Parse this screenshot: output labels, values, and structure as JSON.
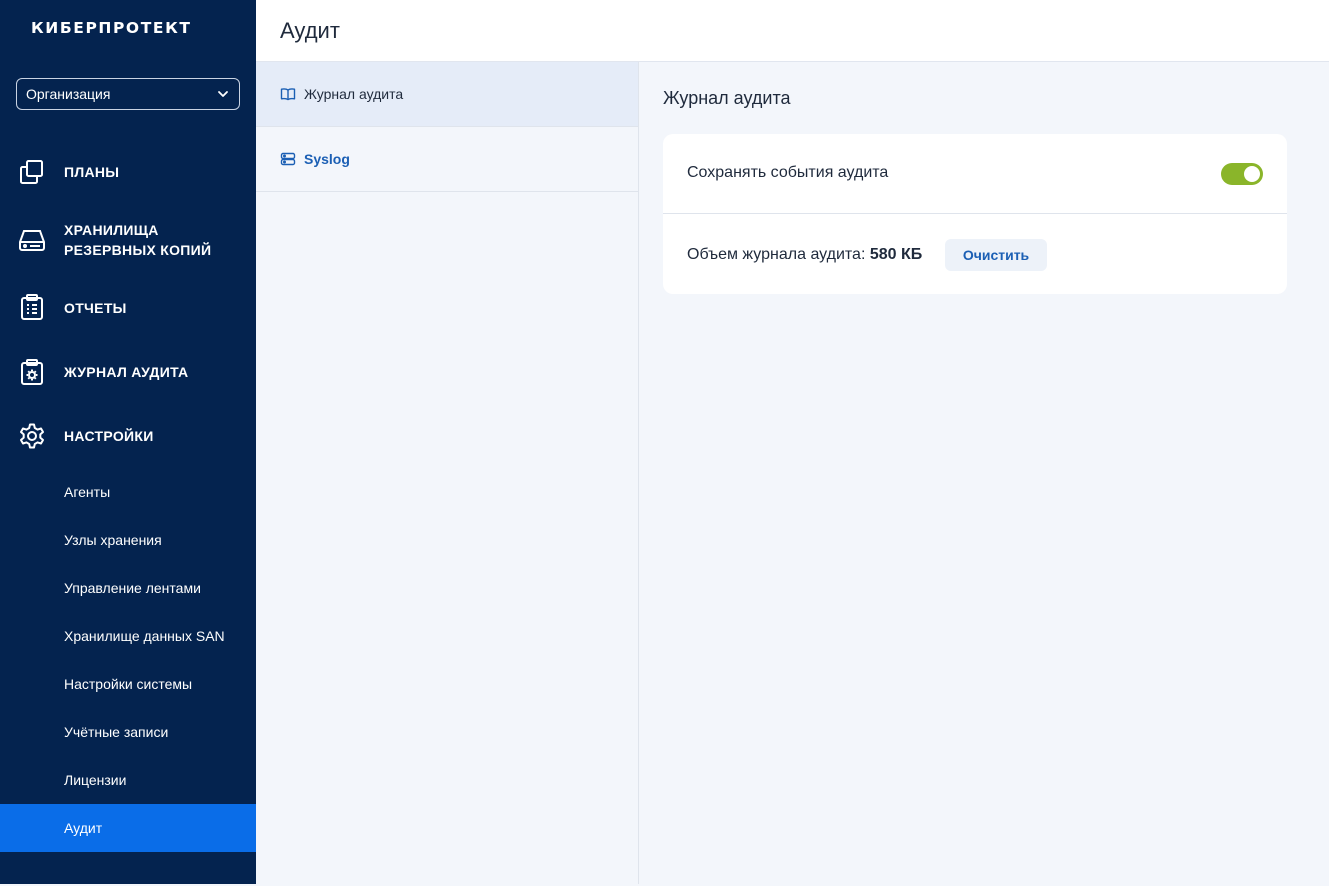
{
  "app": {
    "logo": "КИБЕРПРОТЕКТ"
  },
  "sidebar": {
    "org_select": {
      "value": "Организация"
    },
    "nav": [
      {
        "label": "ПЛАНЫ",
        "icon": "copy-icon"
      },
      {
        "label": "ХРАНИЛИЩА\nРЕЗЕРВНЫХ КОПИЙ",
        "icon": "drive-icon"
      },
      {
        "label": "ОТЧЕТЫ",
        "icon": "clipboard-list-icon"
      },
      {
        "label": "ЖУРНАЛ АУДИТА",
        "icon": "clipboard-gear-icon"
      },
      {
        "label": "НАСТРОЙКИ",
        "icon": "gear-icon"
      }
    ],
    "settings_items": [
      {
        "label": "Агенты"
      },
      {
        "label": "Узлы хранения"
      },
      {
        "label": "Управление лентами"
      },
      {
        "label": "Хранилище данных SAN"
      },
      {
        "label": "Настройки системы"
      },
      {
        "label": "Учётные записи"
      },
      {
        "label": "Лицензии"
      },
      {
        "label": "Аудит",
        "active": true
      }
    ]
  },
  "header": {
    "title": "Аудит"
  },
  "middle": {
    "items": [
      {
        "label": "Журнал аудита",
        "icon": "book-icon",
        "selected": true
      },
      {
        "label": "Syslog",
        "icon": "server-icon",
        "selected": false
      }
    ]
  },
  "content": {
    "section_title": "Журнал аудита",
    "save_events_label": "Сохранять события аудита",
    "save_events_enabled": true,
    "log_size_label": "Объем журнала аудита:",
    "log_size_value": "580 КБ",
    "clear_button": "Очистить"
  },
  "colors": {
    "sidebar_bg": "#04234f",
    "active_item": "#0a6de8",
    "toggle_on": "#8ab52a",
    "link": "#1b5fb4"
  }
}
